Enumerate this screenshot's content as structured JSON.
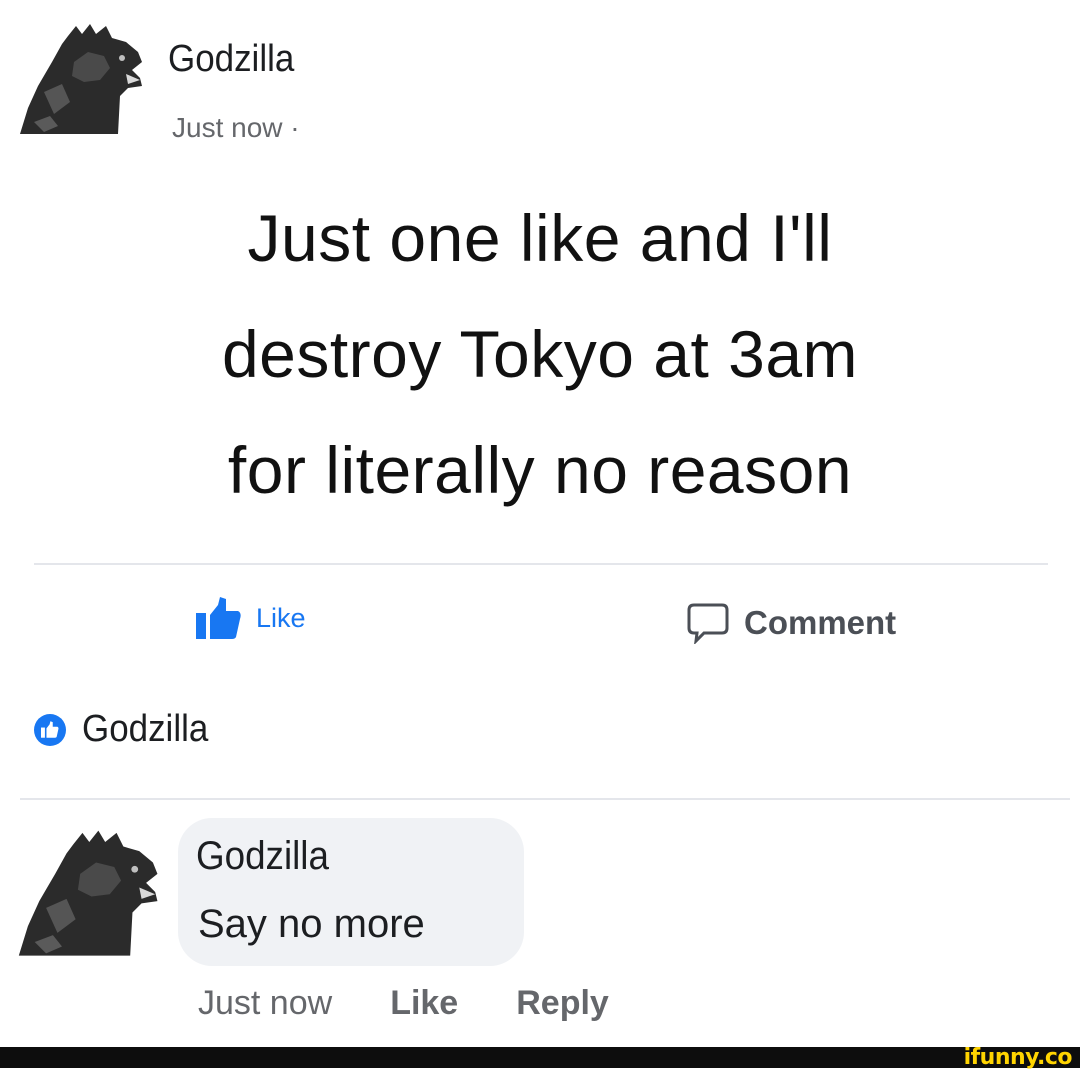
{
  "post": {
    "author": "Godzilla",
    "timestamp": "Just now ·",
    "body_lines": [
      "Just one like and I'll",
      "destroy Tokyo at 3am",
      "for literally no reason"
    ],
    "avatar_icon": "godzilla-avatar-icon"
  },
  "actions": {
    "like_label": "Like",
    "like_icon": "thumbs-up-icon",
    "comment_label": "Comment",
    "comment_icon": "speech-bubble-icon"
  },
  "reactions": {
    "badge_icon": "like-badge-icon",
    "names": "Godzilla"
  },
  "comment": {
    "author": "Godzilla",
    "text": "Say no more",
    "time": "Just now",
    "like_label": "Like",
    "reply_label": "Reply",
    "avatar_icon": "godzilla-avatar-icon"
  },
  "footer": {
    "watermark": "ifunny.co"
  },
  "colors": {
    "accent": "#1877f2",
    "secondary_text": "#65676b",
    "bubble": "#f0f2f5",
    "watermark": "#ffd400"
  }
}
